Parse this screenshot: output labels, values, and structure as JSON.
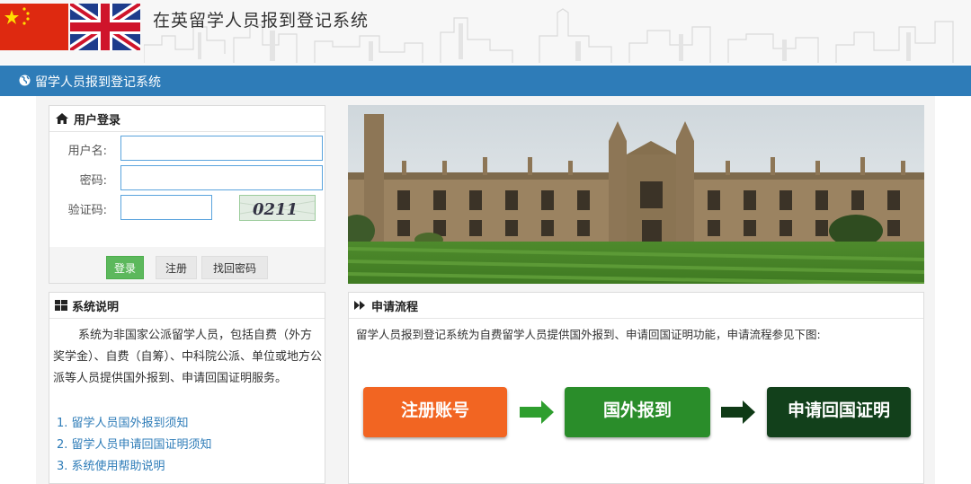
{
  "header": {
    "title": "在英留学人员报到登记系统"
  },
  "nav": {
    "title": "留学人员报到登记系统"
  },
  "login": {
    "title": "用户登录",
    "username_label": "用户名:",
    "password_label": "密码:",
    "captcha_label": "验证码:",
    "captcha_text": "0211",
    "login_button": "登录",
    "register_button": "注册",
    "recover_button": "找回密码"
  },
  "info": {
    "title": "系统说明",
    "text": "系统为非国家公派留学人员，包括自费（外方奖学金）、自费（自筹）、中科院公派、单位或地方公派等人员提供国外报到、申请回国证明服务。",
    "links": [
      "1. 留学人员国外报到须知",
      "2. 留学人员申请回国证明须知",
      "3. 系统使用帮助说明"
    ]
  },
  "flow": {
    "title": "申请流程",
    "description": "留学人员报到登记系统为自费留学人员提供国外报到、申请回国证明功能，申请流程参见下图:",
    "steps": [
      "注册账号",
      "国外报到",
      "申请回国证明"
    ]
  },
  "colors": {
    "nav_bar": "#2e7cb8",
    "login_button": "#5cb85c",
    "step1": "#f26522",
    "step2": "#2a8d2a",
    "step3": "#12401b"
  }
}
